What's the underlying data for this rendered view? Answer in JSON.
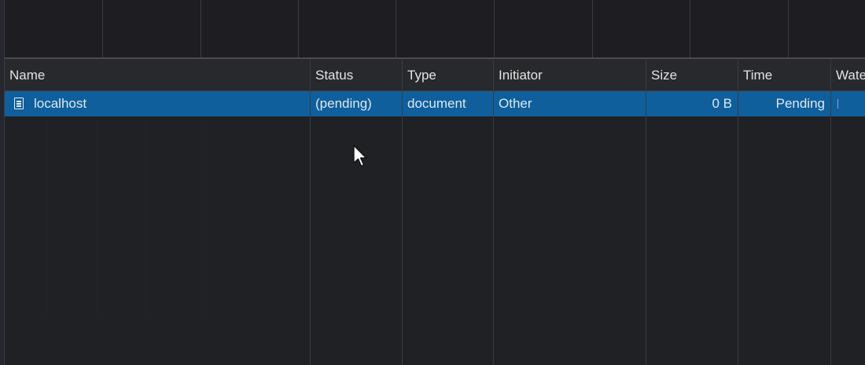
{
  "columns": [
    {
      "key": "name",
      "label": "Name"
    },
    {
      "key": "status",
      "label": "Status"
    },
    {
      "key": "type",
      "label": "Type"
    },
    {
      "key": "initiator",
      "label": "Initiator"
    },
    {
      "key": "size",
      "label": "Size"
    },
    {
      "key": "time",
      "label": "Time"
    },
    {
      "key": "waterfall",
      "label": "Wate"
    }
  ],
  "requests": [
    {
      "icon": "document-icon",
      "name": "localhost",
      "status": "(pending)",
      "type": "document",
      "initiator": "Other",
      "size": "0 B",
      "time": "Pending",
      "selected": true
    }
  ],
  "colors": {
    "background": "#202124",
    "header": "#28292c",
    "selected_row": "#0e5f9c",
    "text": "#e3e3e3"
  }
}
